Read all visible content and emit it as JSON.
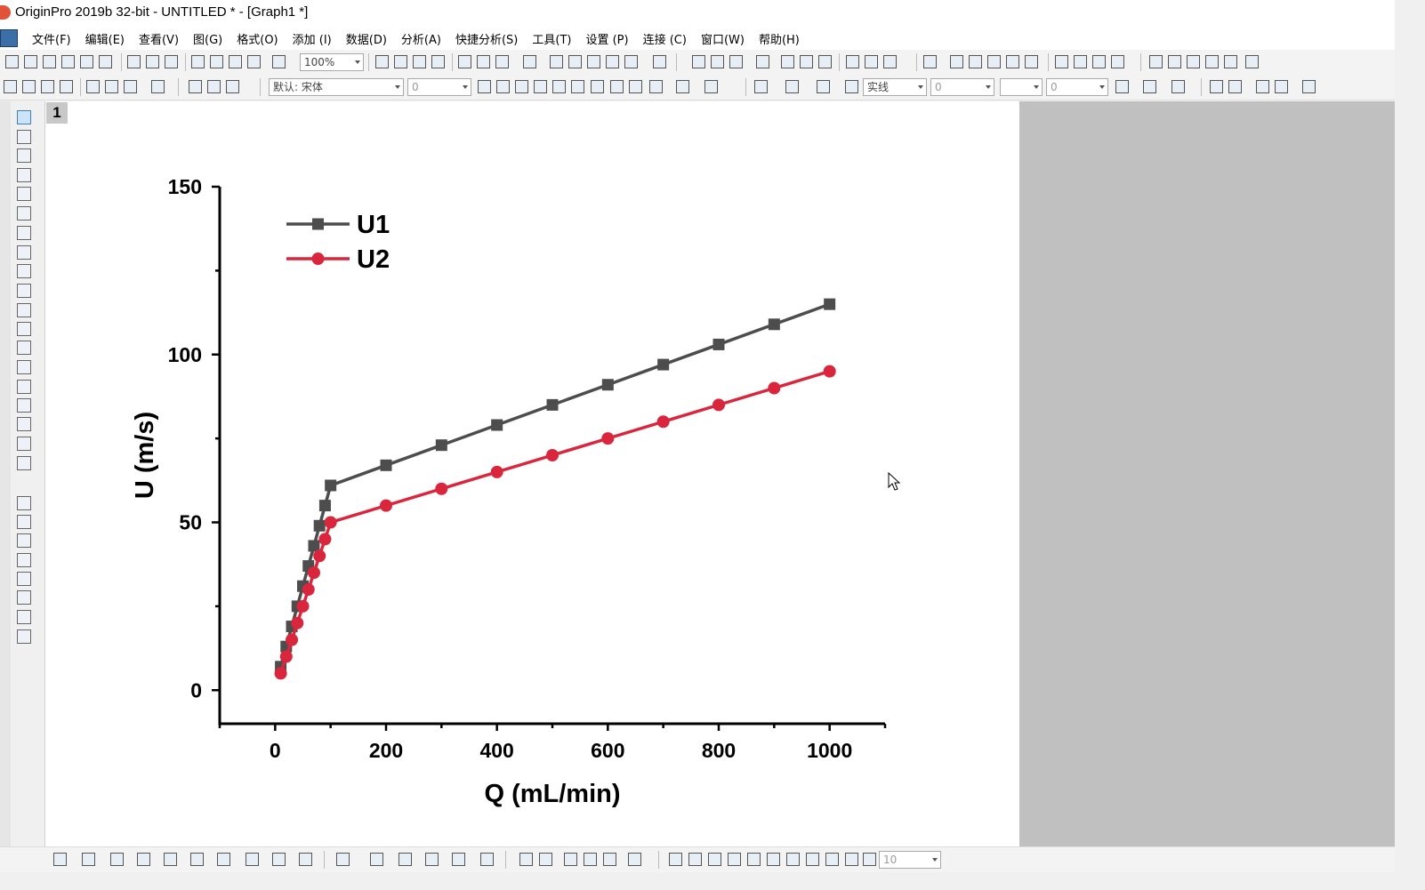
{
  "window": {
    "title": "OriginPro 2019b 32-bit - UNTITLED * - [Graph1 *]"
  },
  "menu": {
    "items": [
      "文件(F)",
      "编辑(E)",
      "查看(V)",
      "图(G)",
      "格式(O)",
      "添加 (I)",
      "数据(D)",
      "分析(A)",
      "快捷分析(S)",
      "工具(T)",
      "设置 (P)",
      "连接 (C)",
      "窗口(W)",
      "帮助(H)"
    ]
  },
  "toolbar": {
    "zoom_value": "100%",
    "font_value": "默认: 宋体",
    "font_size_value": "0",
    "line_width_value": "0",
    "line_style_value": "实线",
    "color_value": "0",
    "bottom_size_value": "10"
  },
  "graph": {
    "layer_number": "1"
  },
  "colors": {
    "series1": "#4d4d4d",
    "series2": "#d9263d",
    "page_bg": "#ffffff",
    "outside_bg": "#c0c0c0"
  },
  "chart_data": {
    "type": "line",
    "xlabel": "Q (mL/min)",
    "ylabel": "U (m/s)",
    "xlim": [
      -100,
      1100
    ],
    "ylim": [
      -10,
      150
    ],
    "xticks": [
      0,
      200,
      400,
      600,
      800,
      1000
    ],
    "yticks": [
      0,
      50,
      100,
      150
    ],
    "legend_position": "top-left",
    "series": [
      {
        "name": "U1",
        "marker": "square",
        "x": [
          10,
          20,
          30,
          40,
          50,
          60,
          70,
          80,
          90,
          100,
          200,
          300,
          400,
          500,
          600,
          700,
          800,
          900,
          1000
        ],
        "y": [
          7,
          13,
          19,
          25,
          31,
          37,
          43,
          49,
          55,
          61,
          67,
          73,
          79,
          85,
          91,
          97,
          103,
          109,
          115
        ]
      },
      {
        "name": "U2",
        "marker": "circle",
        "x": [
          10,
          20,
          30,
          40,
          50,
          60,
          70,
          80,
          90,
          100,
          200,
          300,
          400,
          500,
          600,
          700,
          800,
          900,
          1000
        ],
        "y": [
          5,
          10,
          15,
          20,
          25,
          30,
          35,
          40,
          45,
          50,
          55,
          60,
          65,
          70,
          75,
          80,
          85,
          90,
          95
        ]
      }
    ]
  }
}
